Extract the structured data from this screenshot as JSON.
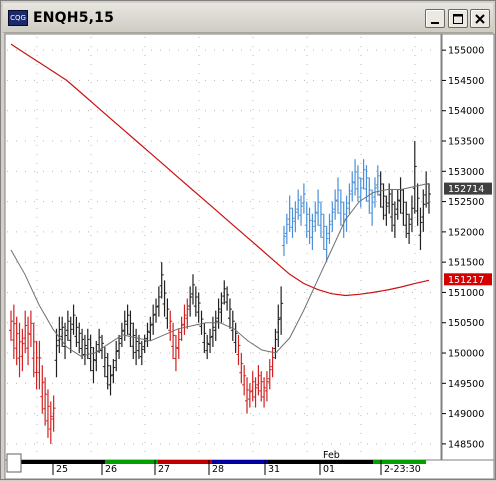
{
  "window": {
    "title": "ENQH5,15",
    "icon": "chart-app-icon",
    "icon_text": "CQG",
    "buttons": [
      "minimize-icon",
      "maximize-icon",
      "close-icon"
    ]
  },
  "colors": {
    "up_bar": "#4a90d9",
    "down_bar": "#d12020",
    "neutral_bar": "#202020",
    "slow_ma": "#cc1111",
    "fast_ma": "#707070",
    "last_price_box": "#404040",
    "ma_price_box": "#d40000",
    "chart_bg": "#ffffff"
  },
  "chart_data": {
    "type": "ohlc-bar",
    "symbol": "ENQH5",
    "interval_minutes": 15,
    "y_ticks": [
      "155000",
      "154500",
      "154000",
      "153500",
      "153000",
      "152500",
      "152000",
      "151500",
      "151000",
      "150500",
      "150000",
      "149500",
      "149000",
      "148500"
    ],
    "ylim": [
      148300,
      155250
    ],
    "last_price": "152714",
    "ma_price": "151217",
    "x_ticks": [
      "25",
      "26",
      "27",
      "28",
      "31",
      "01",
      "2-23:30"
    ],
    "x_month_label": "Feb",
    "x_segment_colors": [
      "#000000",
      "#008000",
      "#c00000",
      "#000090",
      "#000000",
      "#008000"
    ],
    "bars": [
      [
        150700,
        150200
      ],
      [
        150800,
        149900
      ],
      [
        150600,
        149800
      ],
      [
        150500,
        149600
      ],
      [
        150400,
        149700
      ],
      [
        150700,
        150000
      ],
      [
        150600,
        149800
      ],
      [
        150700,
        150100
      ],
      [
        150500,
        149600
      ],
      [
        150200,
        149400
      ],
      [
        150200,
        149400
      ],
      [
        149800,
        149000
      ],
      [
        149600,
        148800
      ],
      [
        149400,
        148600
      ],
      [
        149200,
        148500
      ],
      [
        149300,
        148700
      ],
      [
        150400,
        149600
      ],
      [
        150600,
        150000
      ],
      [
        150600,
        150100
      ],
      [
        150500,
        149900
      ],
      [
        150700,
        150200
      ],
      [
        150600,
        150000
      ],
      [
        150800,
        150300
      ],
      [
        150600,
        150100
      ],
      [
        150500,
        150000
      ],
      [
        150400,
        149900
      ],
      [
        150300,
        149800
      ],
      [
        150400,
        149900
      ],
      [
        150300,
        149700
      ],
      [
        150100,
        149500
      ],
      [
        150200,
        149700
      ],
      [
        150400,
        150000
      ],
      [
        150300,
        149900
      ],
      [
        150100,
        149600
      ],
      [
        150000,
        149400
      ],
      [
        149800,
        149300
      ],
      [
        149900,
        149500
      ],
      [
        150200,
        149700
      ],
      [
        150300,
        149900
      ],
      [
        150500,
        150100
      ],
      [
        150700,
        150200
      ],
      [
        150800,
        150300
      ],
      [
        150700,
        150100
      ],
      [
        150500,
        149900
      ],
      [
        150400,
        149800
      ],
      [
        150300,
        149900
      ],
      [
        150200,
        149800
      ],
      [
        150300,
        150000
      ],
      [
        150500,
        150100
      ],
      [
        150600,
        150200
      ],
      [
        150800,
        150300
      ],
      [
        150900,
        150500
      ],
      [
        151100,
        150600
      ],
      [
        151500,
        150900
      ],
      [
        151200,
        150600
      ],
      [
        150900,
        150400
      ],
      [
        150700,
        150200
      ],
      [
        150500,
        149900
      ],
      [
        150300,
        149700
      ],
      [
        150400,
        149900
      ],
      [
        150600,
        150200
      ],
      [
        150800,
        150300
      ],
      [
        150900,
        150400
      ],
      [
        151100,
        150600
      ],
      [
        151300,
        150800
      ],
      [
        151100,
        150600
      ],
      [
        151000,
        150500
      ],
      [
        150700,
        150300
      ],
      [
        150500,
        150000
      ],
      [
        150300,
        149900
      ],
      [
        150400,
        150000
      ],
      [
        150600,
        150100
      ],
      [
        150700,
        150200
      ],
      [
        150900,
        150400
      ],
      [
        151000,
        150500
      ],
      [
        151200,
        150800
      ],
      [
        151100,
        150700
      ],
      [
        150900,
        150400
      ],
      [
        150700,
        150200
      ],
      [
        150500,
        150000
      ],
      [
        150300,
        149800
      ],
      [
        150000,
        149500
      ],
      [
        149800,
        149300
      ],
      [
        149600,
        149000
      ],
      [
        149500,
        149100
      ],
      [
        149700,
        149200
      ],
      [
        149600,
        149100
      ],
      [
        149800,
        149300
      ],
      [
        149700,
        149200
      ],
      [
        149600,
        149100
      ],
      [
        149700,
        149200
      ],
      [
        149900,
        149400
      ],
      [
        150100,
        149600
      ],
      [
        150400,
        149900
      ],
      [
        150800,
        150100
      ],
      [
        151100,
        150300
      ],
      [
        152100,
        151600
      ],
      [
        152300,
        151800
      ],
      [
        152600,
        152000
      ],
      [
        152400,
        151900
      ],
      [
        152500,
        152000
      ],
      [
        152700,
        152200
      ],
      [
        152600,
        152100
      ],
      [
        152800,
        152300
      ],
      [
        152500,
        151900
      ],
      [
        152400,
        151800
      ],
      [
        152300,
        151700
      ],
      [
        152500,
        152000
      ],
      [
        152700,
        152100
      ],
      [
        152500,
        151900
      ],
      [
        152300,
        151700
      ],
      [
        152100,
        151500
      ],
      [
        152300,
        151800
      ],
      [
        152500,
        152000
      ],
      [
        152700,
        152200
      ],
      [
        152900,
        152300
      ],
      [
        152700,
        152100
      ],
      [
        152500,
        151900
      ],
      [
        152600,
        152000
      ],
      [
        152800,
        152300
      ],
      [
        153000,
        152500
      ],
      [
        153200,
        152600
      ],
      [
        153100,
        152500
      ],
      [
        152900,
        152400
      ],
      [
        153200,
        152700
      ],
      [
        153100,
        152500
      ],
      [
        152900,
        152300
      ],
      [
        152700,
        152100
      ],
      [
        152900,
        152400
      ],
      [
        153100,
        152600
      ],
      [
        153000,
        152400
      ],
      [
        152800,
        152200
      ],
      [
        152600,
        152100
      ],
      [
        152800,
        152300
      ],
      [
        152700,
        152000
      ],
      [
        152500,
        151900
      ],
      [
        152700,
        152200
      ],
      [
        152900,
        152300
      ],
      [
        152700,
        152100
      ],
      [
        152500,
        151900
      ],
      [
        152300,
        151800
      ],
      [
        152600,
        152000
      ],
      [
        153500,
        152300
      ],
      [
        152800,
        152100
      ],
      [
        152400,
        151700
      ],
      [
        152700,
        152000
      ],
      [
        153000,
        152400
      ],
      [
        152800,
        152300
      ]
    ],
    "bar_colors": [
      "d",
      "d",
      "d",
      "d",
      "d",
      "d",
      "d",
      "d",
      "d",
      "d",
      "d",
      "d",
      "d",
      "d",
      "d",
      "d",
      "n",
      "n",
      "n",
      "n",
      "n",
      "n",
      "n",
      "n",
      "n",
      "n",
      "n",
      "n",
      "n",
      "n",
      "n",
      "n",
      "n",
      "n",
      "n",
      "n",
      "n",
      "n",
      "n",
      "n",
      "n",
      "n",
      "n",
      "n",
      "n",
      "n",
      "n",
      "n",
      "n",
      "n",
      "n",
      "n",
      "n",
      "n",
      "n",
      "n",
      "d",
      "d",
      "d",
      "d",
      "d",
      "d",
      "d",
      "n",
      "n",
      "n",
      "n",
      "n",
      "n",
      "n",
      "n",
      "n",
      "n",
      "n",
      "n",
      "n",
      "n",
      "n",
      "n",
      "n",
      "d",
      "d",
      "d",
      "d",
      "d",
      "d",
      "d",
      "d",
      "d",
      "d",
      "d",
      "d",
      "d",
      "n",
      "n",
      "n",
      "u",
      "u",
      "u",
      "u",
      "u",
      "u",
      "u",
      "u",
      "u",
      "u",
      "u",
      "u",
      "u",
      "u",
      "u",
      "u",
      "u",
      "u",
      "u",
      "u",
      "u",
      "u",
      "u",
      "u",
      "u",
      "u",
      "u",
      "u",
      "u",
      "u",
      "u",
      "u",
      "u",
      "u",
      "n",
      "n",
      "n",
      "n",
      "n",
      "n",
      "n",
      "n",
      "n",
      "n",
      "n",
      "n",
      "n",
      "n",
      "n",
      "n",
      "n",
      "n"
    ],
    "slow_ma": [
      155100,
      154950,
      154800,
      154650,
      154500,
      154300,
      154100,
      153900,
      153700,
      153500,
      153300,
      153100,
      152900,
      152700,
      152500,
      152300,
      152100,
      151900,
      151700,
      151500,
      151300,
      151150,
      151050,
      150980,
      150950,
      150970,
      151000,
      151040,
      151090,
      151150,
      151200
    ],
    "fast_ma": [
      151700,
      151300,
      150800,
      150400,
      150100,
      149950,
      150000,
      150150,
      150300,
      150250,
      150200,
      150300,
      150400,
      150450,
      150500,
      150500,
      150400,
      150200,
      150050,
      150000,
      150250,
      150700,
      151200,
      151700,
      152200,
      152500,
      152650,
      152700,
      152700,
      152750,
      152800
    ]
  }
}
